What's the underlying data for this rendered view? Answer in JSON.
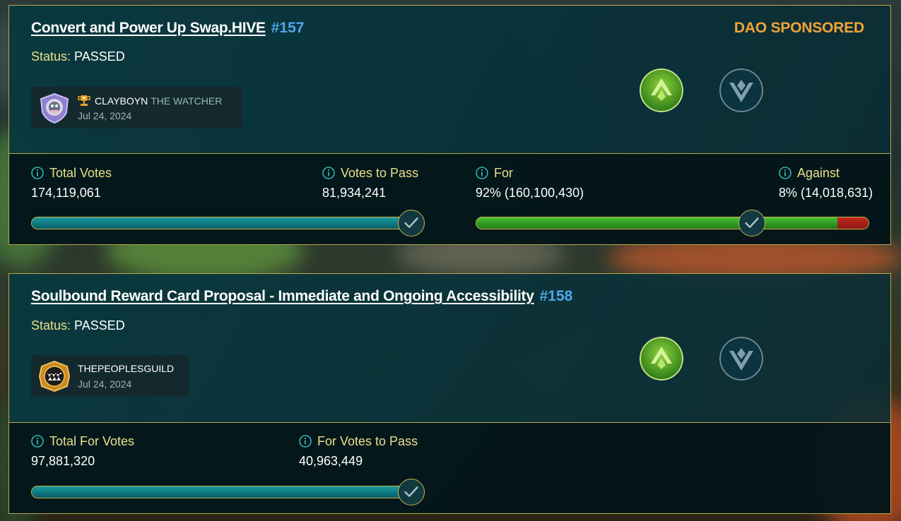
{
  "proposals": [
    {
      "title": "Convert and Power Up Swap.HIVE",
      "number": "#157",
      "badge": "DAO SPONSORED",
      "status_label": "Status:",
      "status_value": "PASSED",
      "author": {
        "name": "CLAYBOYN",
        "title": "THE WATCHER",
        "date": "Jul 24, 2024",
        "avatar_icon": "guild-shield-avatar-icon",
        "rank_icon": "trophy-icon"
      },
      "stats": [
        {
          "label": "Total Votes",
          "value": "174,119,061"
        },
        {
          "label": "Votes to Pass",
          "value": "81,934,241"
        },
        {
          "label": "For",
          "value": "92% (160,100,430)"
        },
        {
          "label": "Against",
          "value": "8% (14,018,631)"
        }
      ],
      "progress": {
        "votes_fraction": 1.0,
        "for_fraction": 0.92,
        "against_fraction": 0.08
      }
    },
    {
      "title": "Soulbound Reward Card Proposal - Immediate and Ongoing Accessibility",
      "number": "#158",
      "status_label": "Status:",
      "status_value": "PASSED",
      "author": {
        "name": "THEPEOPLESGUILD",
        "date": "Jul 24, 2024",
        "avatar_icon": "fanged-guild-avatar-icon"
      },
      "stats": [
        {
          "label": "Total For Votes",
          "value": "97,881,320"
        },
        {
          "label": "For Votes to Pass",
          "value": "40,963,449"
        }
      ],
      "progress": {
        "votes_fraction": 1.0
      }
    }
  ],
  "colors": {
    "accent_gold": "#f0a437",
    "link_blue": "#4fa6ec",
    "label_yellow": "#e8e08a",
    "for_green": "#2e9a24",
    "against_red": "#c02a20",
    "teal": "#0e7880"
  },
  "icons": {
    "upvote": "upvote-arrow-icon",
    "downvote": "downvote-chevron-icon",
    "info": "info-icon",
    "check": "checkmark-icon"
  }
}
